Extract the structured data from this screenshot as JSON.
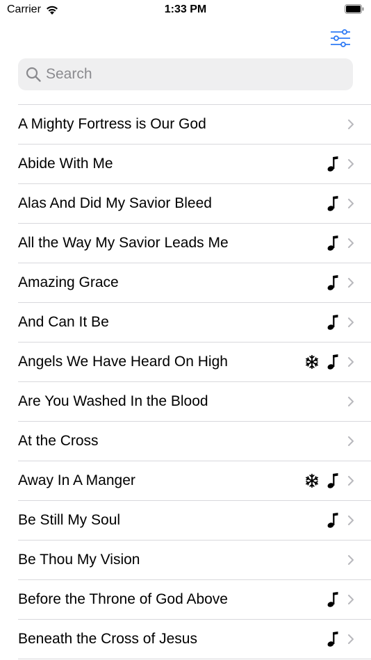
{
  "status_bar": {
    "carrier": "Carrier",
    "time": "1:33 PM"
  },
  "accent_color": "#2f7bf5",
  "search": {
    "placeholder": "Search",
    "value": ""
  },
  "hymns": [
    {
      "title": "A Mighty Fortress is Our God",
      "christmas": false,
      "audio": false
    },
    {
      "title": "Abide With Me",
      "christmas": false,
      "audio": true
    },
    {
      "title": "Alas And Did My Savior Bleed",
      "christmas": false,
      "audio": true
    },
    {
      "title": "All the Way My Savior Leads Me",
      "christmas": false,
      "audio": true
    },
    {
      "title": "Amazing Grace",
      "christmas": false,
      "audio": true
    },
    {
      "title": "And Can It Be",
      "christmas": false,
      "audio": true
    },
    {
      "title": "Angels We Have Heard On High",
      "christmas": true,
      "audio": true
    },
    {
      "title": "Are You Washed In the Blood",
      "christmas": false,
      "audio": false
    },
    {
      "title": "At the Cross",
      "christmas": false,
      "audio": false
    },
    {
      "title": "Away In A Manger",
      "christmas": true,
      "audio": true
    },
    {
      "title": "Be Still My Soul",
      "christmas": false,
      "audio": true
    },
    {
      "title": "Be Thou My Vision",
      "christmas": false,
      "audio": false
    },
    {
      "title": "Before the Throne of God Above",
      "christmas": false,
      "audio": true
    },
    {
      "title": "Beneath the Cross of Jesus",
      "christmas": false,
      "audio": true
    }
  ]
}
